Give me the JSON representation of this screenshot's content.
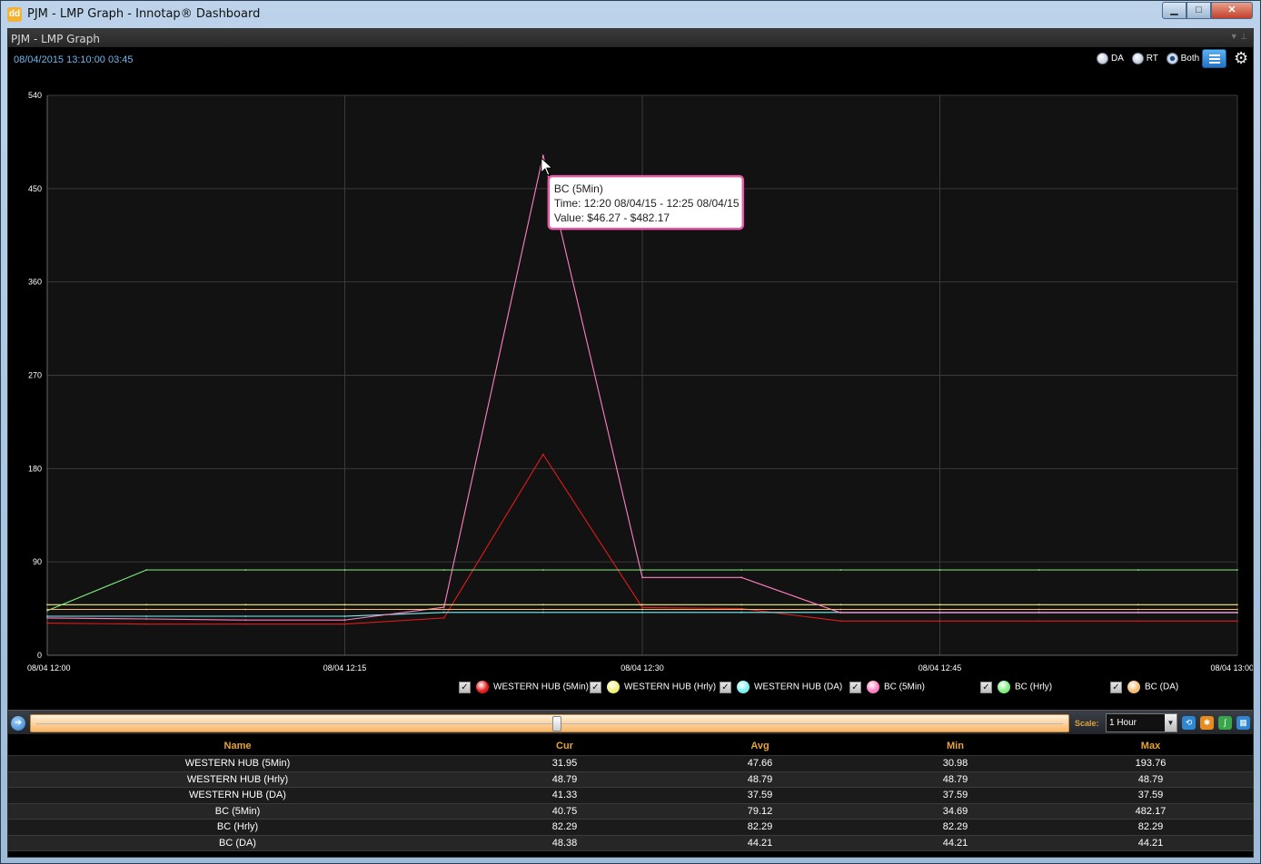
{
  "window": {
    "title": "PJM - LMP Graph - Innotap® Dashboard",
    "app_icon": "dd"
  },
  "panel": {
    "title": "PJM - LMP Graph",
    "timestamp": "08/04/2015 13:10:00  03:45"
  },
  "view_options": [
    {
      "label": "DA",
      "selected": false
    },
    {
      "label": "RT",
      "selected": false
    },
    {
      "label": "Both",
      "selected": true
    }
  ],
  "icons": {
    "menu": "list-icon",
    "settings": "gear-icon",
    "play": "play-arrow-icon",
    "min": "minimize-icon",
    "max": "maximize-icon",
    "close": "close-icon",
    "pin": "pin-icon"
  },
  "chart_data": {
    "type": "line",
    "title": "",
    "xlabel": "",
    "ylabel": "",
    "x": [
      "08/04 12:00",
      "08/04 12:05",
      "08/04 12:10",
      "08/04 12:15",
      "08/04 12:20",
      "08/04 12:25",
      "08/04 12:30",
      "08/04 12:35",
      "08/04 12:40",
      "08/04 12:45",
      "08/04 12:50",
      "08/04 12:55",
      "08/04 13:00"
    ],
    "xticks": [
      "08/04 12:00",
      "08/04 12:15",
      "08/04 12:30",
      "08/04 12:45",
      "08/04 13:00"
    ],
    "ylim": [
      0,
      540
    ],
    "yticks": [
      0,
      90,
      180,
      270,
      360,
      450,
      540
    ],
    "grid": true,
    "series": [
      {
        "name": "WESTERN HUB (5Min)",
        "color": "#e31b1b",
        "values": [
          31,
          30,
          30,
          30,
          36,
          193.76,
          46,
          45,
          33,
          33,
          33,
          33,
          33
        ]
      },
      {
        "name": "WESTERN HUB (Hrly)",
        "color": "#f0f07a",
        "values": [
          48.79,
          48.79,
          48.79,
          48.79,
          48.79,
          48.79,
          48.79,
          48.79,
          48.79,
          48.79,
          48.79,
          48.79,
          48.79
        ]
      },
      {
        "name": "WESTERN HUB (DA)",
        "color": "#7df0f0",
        "values": [
          37.59,
          37.59,
          37.59,
          37.59,
          41.33,
          41.33,
          41.33,
          41.33,
          41.33,
          41.33,
          41.33,
          41.33,
          41.33
        ]
      },
      {
        "name": "BC (5Min)",
        "color": "#ff7fc2",
        "values": [
          36,
          35,
          34,
          34,
          46.27,
          482.17,
          75,
          75,
          41,
          41,
          41,
          41,
          41
        ]
      },
      {
        "name": "BC (Hrly)",
        "color": "#7ef07e",
        "values": [
          43,
          82.29,
          82.29,
          82.29,
          82.29,
          82.29,
          82.29,
          82.29,
          82.29,
          82.29,
          82.29,
          82.29,
          82.29
        ]
      },
      {
        "name": "BC (DA)",
        "color": "#f2bd70",
        "values": [
          44.21,
          44.21,
          44.21,
          44.21,
          44.21,
          44.21,
          44.21,
          44.21,
          44.21,
          44.21,
          44.21,
          44.21,
          44.21
        ]
      }
    ],
    "tooltip": {
      "series": "BC (5Min)",
      "line1": "BC (5Min)",
      "line2": "Time: 12:20 08/04/15 - 12:25 08/04/15",
      "line3": "Value: $46.27 - $482.17"
    }
  },
  "legend": [
    {
      "label": "WESTERN HUB (5Min)",
      "color": "#e31b1b",
      "checked": true
    },
    {
      "label": "WESTERN HUB (Hrly)",
      "color": "#f0f07a",
      "checked": true
    },
    {
      "label": "WESTERN HUB (DA)",
      "color": "#7df0f0",
      "checked": true
    },
    {
      "label": "BC (5Min)",
      "color": "#ff7fc2",
      "checked": true
    },
    {
      "label": "BC (Hrly)",
      "color": "#7ef07e",
      "checked": true
    },
    {
      "label": "BC (DA)",
      "color": "#f2bd70",
      "checked": true
    }
  ],
  "scroller": {
    "scale_label": "Scale:",
    "scale_value": "1 Hour",
    "position": 0.5
  },
  "stats": {
    "headers": [
      "Name",
      "Cur",
      "Avg",
      "Min",
      "Max"
    ],
    "rows": [
      [
        "WESTERN HUB (5Min)",
        "31.95",
        "47.66",
        "30.98",
        "193.76"
      ],
      [
        "WESTERN HUB (Hrly)",
        "48.79",
        "48.79",
        "48.79",
        "48.79"
      ],
      [
        "WESTERN HUB (DA)",
        "41.33",
        "37.59",
        "37.59",
        "37.59"
      ],
      [
        "BC (5Min)",
        "40.75",
        "79.12",
        "34.69",
        "482.17"
      ],
      [
        "BC (Hrly)",
        "82.29",
        "82.29",
        "82.29",
        "82.29"
      ],
      [
        "BC (DA)",
        "48.38",
        "44.21",
        "44.21",
        "44.21"
      ]
    ]
  },
  "check_glyph": "✓"
}
